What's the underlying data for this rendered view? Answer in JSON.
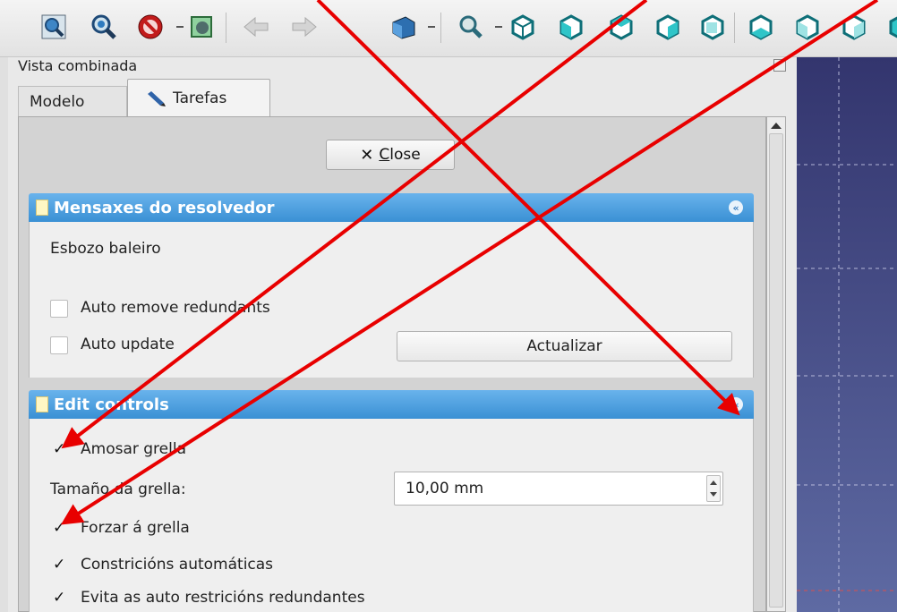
{
  "panel": {
    "title": "Vista combinada",
    "tabs": [
      {
        "label": "Modelo"
      },
      {
        "label": "Tarefas"
      }
    ]
  },
  "close_button": {
    "icon": "x-icon",
    "label_prefix": "",
    "label_underlined": "C",
    "label_rest": "lose"
  },
  "solver_section": {
    "title": "Mensaxes do resolvedor",
    "status": "Esbozo baleiro",
    "auto_remove_redundants": {
      "label": "Auto remove redundants",
      "checked": false
    },
    "auto_update": {
      "label": "Auto update",
      "checked": false
    },
    "update_button": "Actualizar"
  },
  "edit_section": {
    "title": "Edit controls",
    "show_grid": {
      "label": "Amosar grella",
      "checked": true
    },
    "grid_size_label": "Tamaño da grella:",
    "grid_size_value": "10,00 mm",
    "snap_grid": {
      "label": "Forzar á grella",
      "checked": true
    },
    "auto_constraints": {
      "label": "Constricións automáticas",
      "checked": true
    },
    "avoid_redundant": {
      "label": "Evita as auto restricións redundantes",
      "checked": true
    }
  },
  "toolbar_icons": [
    "fit-all-icon",
    "fit-selection-icon",
    "draw-style-icon",
    "bounding-box-icon",
    "back-icon",
    "forward-icon",
    "workbench-icon",
    "zoom-icon",
    "isometric-view-icon",
    "front-view-icon",
    "top-view-icon",
    "right-view-icon",
    "rear-view-icon",
    "bottom-view-icon",
    "left-view-icon"
  ],
  "colors": {
    "section_header": "#3a90d4",
    "annotation": "#e80000",
    "view_background": "#44477f"
  }
}
